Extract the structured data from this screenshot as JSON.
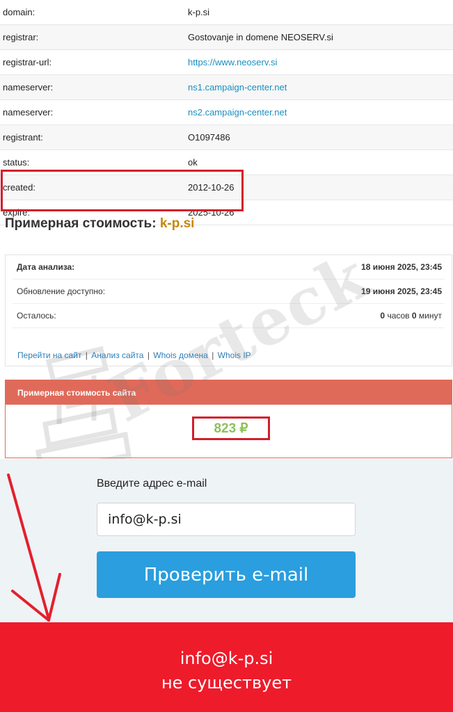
{
  "whois": [
    {
      "key": "domain:",
      "value": "k-p.si"
    },
    {
      "key": "registrar:",
      "value": "Gostovanje in domene NEOSERV.si"
    },
    {
      "key": "registrar-url:",
      "value": "https://www.neoserv.si"
    },
    {
      "key": "nameserver:",
      "value": "ns1.campaign-center.net"
    },
    {
      "key": "nameserver:",
      "value": "ns2.campaign-center.net"
    },
    {
      "key": "registrant:",
      "value": "O1097486"
    },
    {
      "key": "status:",
      "value": "ok"
    },
    {
      "key": "created:",
      "value": "2012-10-26"
    },
    {
      "key": "expire:",
      "value": "2025-10-26"
    }
  ],
  "estimate": {
    "title": "Примерная стоимость:",
    "domain": "k-p.si"
  },
  "analysis": {
    "date_label": "Дата анализа:",
    "date_value": "18 июня 2025, 23:45",
    "update_label": "Обновление доступно:",
    "update_value": "19 июня 2025, 23:45",
    "left_label": "Осталось:",
    "left_hours": "0",
    "left_hours_unit": "часов",
    "left_minutes": "0",
    "left_minutes_unit": "минут",
    "links": [
      "Перейти на сайт",
      "Анализ сайта",
      "Whois домена",
      "Whois IP"
    ],
    "sep": "|"
  },
  "site_price": {
    "header": "Примерная стоимость сайта",
    "value": "823 ₽"
  },
  "watermark": "Forteck",
  "email_check": {
    "label": "Введите адрес e-mail",
    "input_value": "info@k-p.si",
    "button": "Проверить e-mail"
  },
  "result": {
    "email": "info@k-p.si",
    "status": "не существует"
  },
  "colors": {
    "highlight": "#d21e2b",
    "result_bg": "#ee1b2b",
    "button": "#2a9ede",
    "price": "#8dc05a",
    "domain_accent": "#c8860a"
  }
}
